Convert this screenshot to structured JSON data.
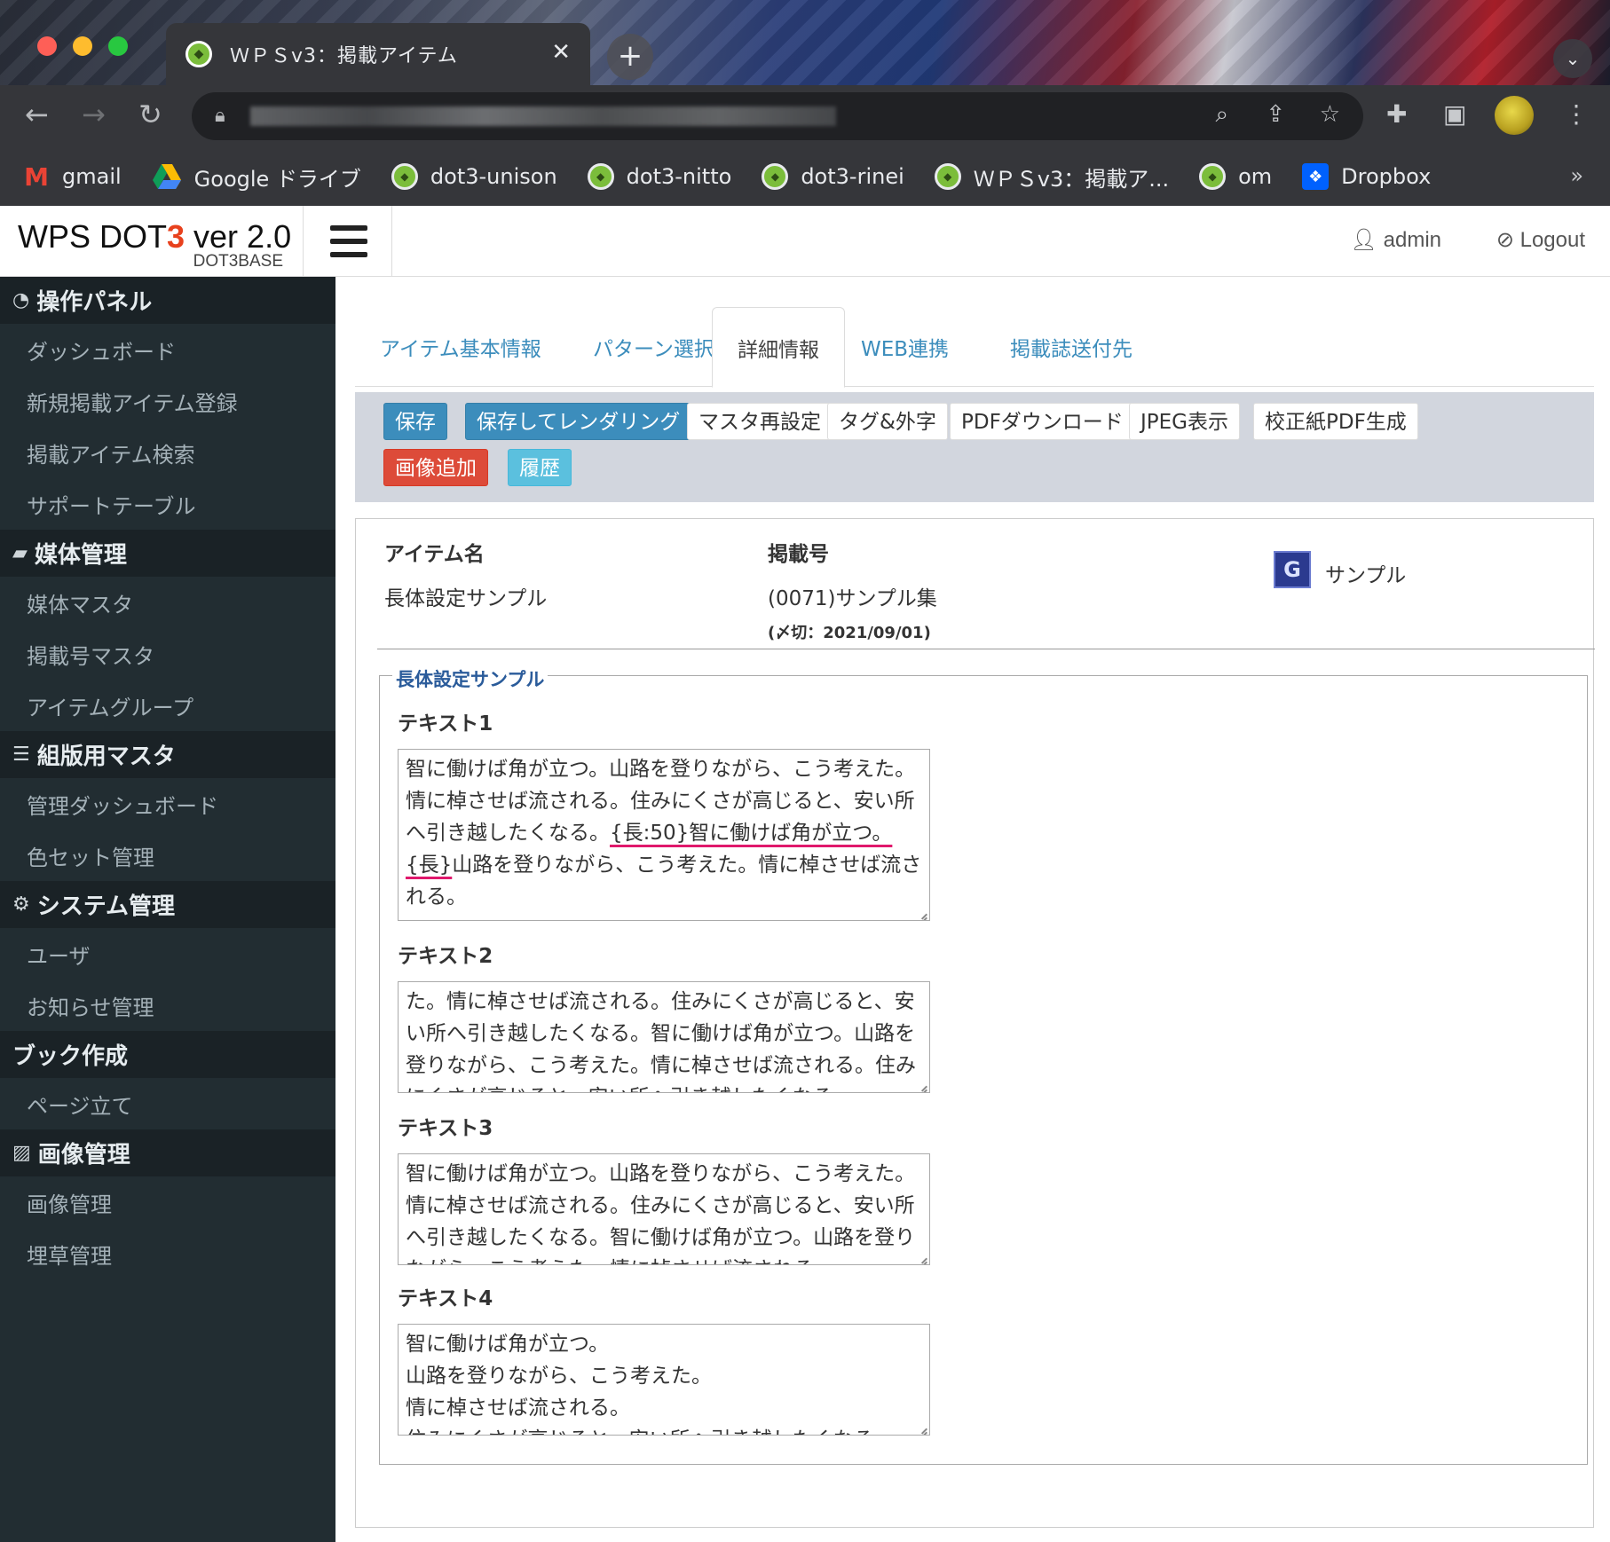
{
  "browser": {
    "tab_title": "ＷＰＳv3：掲載アイテム",
    "bookmarks": [
      {
        "label": "gmail",
        "icon": "gmail-icon"
      },
      {
        "label": "Google ドライブ",
        "icon": "google-drive-icon"
      },
      {
        "label": "dot3-unison",
        "icon": "dot3-favicon"
      },
      {
        "label": "dot3-nitto",
        "icon": "dot3-favicon"
      },
      {
        "label": "dot3-rinei",
        "icon": "dot3-favicon"
      },
      {
        "label": "ＷＰＳv3：掲載ア...",
        "icon": "dot3-favicon"
      },
      {
        "label": "om",
        "icon": "dot3-favicon"
      },
      {
        "label": "Dropbox",
        "icon": "dropbox-icon"
      }
    ],
    "more_bookmarks": "»"
  },
  "header": {
    "brand_prefix": "WPS DOT",
    "brand_accent": "3",
    "brand_suffix": " ver 2.0",
    "brand_sub": "DOT3BASE",
    "user": "admin",
    "logout": "Logout"
  },
  "sidebar": {
    "groups": [
      {
        "title": "操作パネル",
        "icon": "dashboard-icon",
        "items": [
          "ダッシュボード",
          "新規掲載アイテム登録",
          "掲載アイテム検索",
          "サポートテーブル"
        ]
      },
      {
        "title": "媒体管理",
        "icon": "book-icon",
        "items": [
          "媒体マスタ",
          "掲載号マスタ",
          "アイテムグループ"
        ]
      },
      {
        "title": "組版用マスタ",
        "icon": "database-icon",
        "items": [
          "管理ダッシュボード",
          "色セット管理"
        ]
      },
      {
        "title": "システム管理",
        "icon": "cogs-icon",
        "items": [
          "ユーザ",
          "お知らせ管理"
        ]
      },
      {
        "title": "ブック作成",
        "icon": "",
        "items": [
          "ページ立て"
        ]
      },
      {
        "title": "画像管理",
        "icon": "image-icon",
        "items": [
          "画像管理",
          "埋草管理"
        ]
      }
    ]
  },
  "tabs": [
    "アイテム基本情報",
    "パターン選択",
    "詳細情報",
    "WEB連携",
    "掲載誌送付先"
  ],
  "active_tab": "詳細情報",
  "actions": {
    "save": "保存",
    "save_render": "保存してレンダリング",
    "master_reset": "マスタ再設定",
    "tags": "タグ&外字",
    "pdf_download": "PDFダウンロード",
    "jpeg_view": "JPEG表示",
    "proof_pdf": "校正紙PDF生成",
    "add_image": "画像追加",
    "history": "履歴"
  },
  "item_info": {
    "name_label": "アイテム名",
    "name_value": "長体設定サンプル",
    "issue_label": "掲載号",
    "issue_value": "(0071)サンプル集",
    "deadline": "(〆切：2021/09/01)",
    "group_badge": "G",
    "group_name": "サンプル"
  },
  "fieldset": {
    "legend": "長体設定サンプル",
    "fields": [
      {
        "label": "テキスト1",
        "part1": "智に働けば角が立つ。山路を登りながら、こう考えた。情に棹させば流される。住みにくさが高じると、安い所へ引き越したくなる。",
        "marked": "{長:50}智に働けば角が立つ。{長}",
        "part2": "山路を登りながら、こう考えた。情に棹させば流される。"
      },
      {
        "label": "テキスト2",
        "value": "た。情に棹させば流される。住みにくさが高じると、安い所へ引き越したくなる。智に働けば角が立つ。山路を登りながら、こう考えた。情に棹させば流される。住みにくさが高じると、安い所へ引き越したくなる。"
      },
      {
        "label": "テキスト3",
        "value": "智に働けば角が立つ。山路を登りながら、こう考えた。情に棹させば流される。住みにくさが高じると、安い所へ引き越したくなる。智に働けば角が立つ。山路を登りながら、こう考えた。情に棹させば流される。"
      },
      {
        "label": "テキスト4",
        "value": "智に働けば角が立つ。\n山路を登りながら、こう考えた。\n情に棹させば流される。\n住みにくさが高じると、安い所へ引き越したくなる。"
      }
    ]
  }
}
